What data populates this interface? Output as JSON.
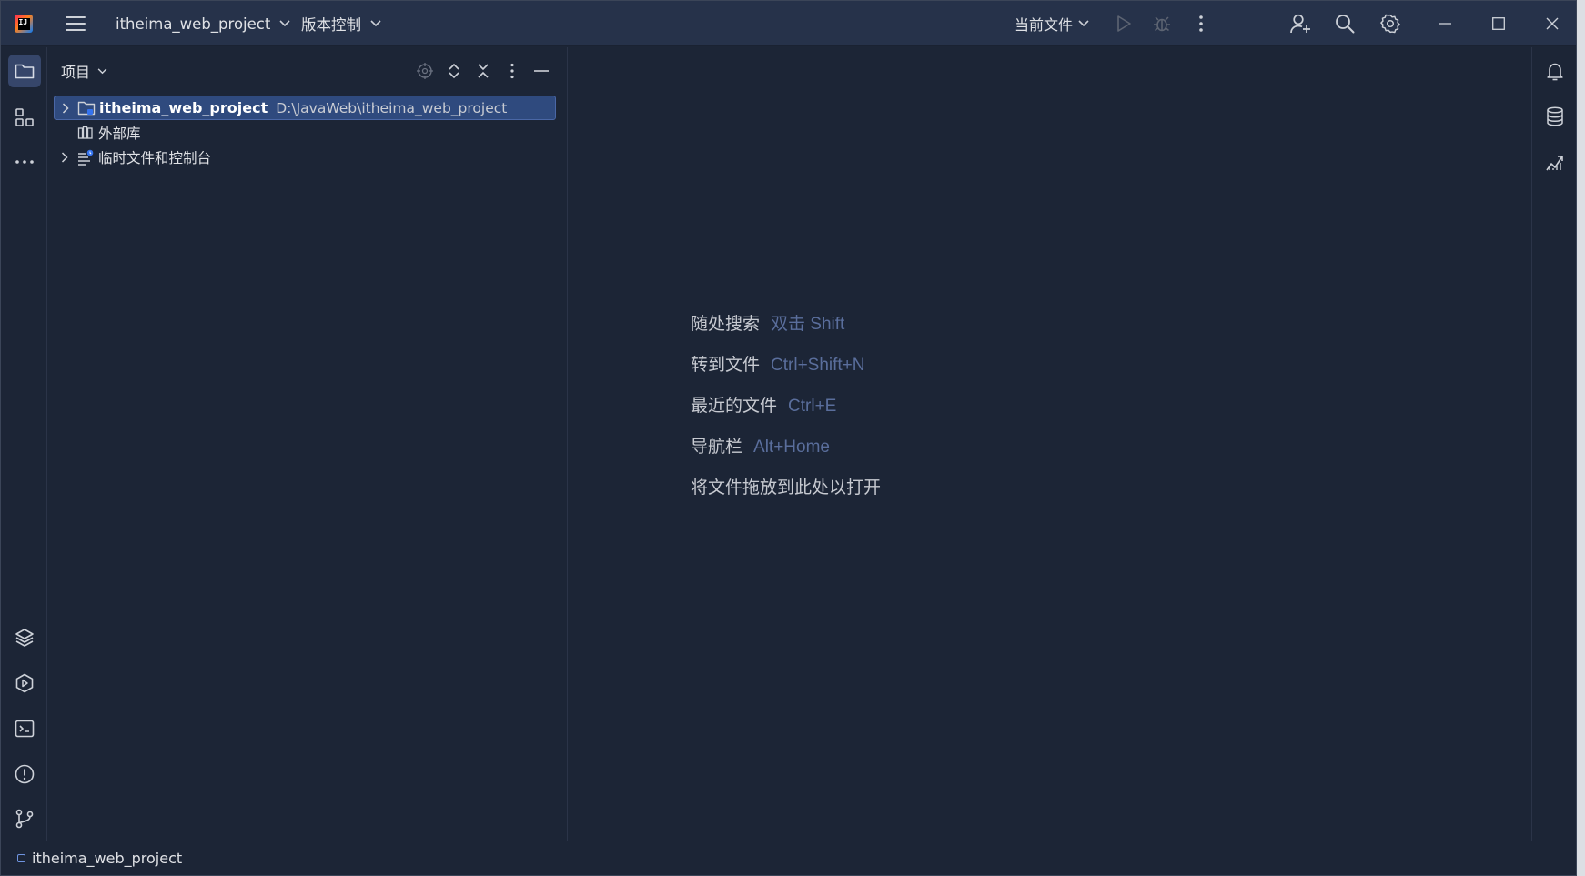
{
  "titlebar": {
    "logo_text": "IJ",
    "project_name": "itheima_web_project",
    "vcs_label": "版本控制",
    "run_config": "当前文件"
  },
  "project_panel": {
    "title": "项目",
    "tree": [
      {
        "name": "itheima_web_project",
        "path": "D:\\JavaWeb\\itheima_web_project",
        "expandable": true,
        "selected": true
      },
      {
        "name": "外部库",
        "expandable": false
      },
      {
        "name": "临时文件和控制台",
        "expandable": true
      }
    ]
  },
  "editor_hints": [
    {
      "label": "随处搜索",
      "shortcut": "双击 Shift"
    },
    {
      "label": "转到文件",
      "shortcut": "Ctrl+Shift+N"
    },
    {
      "label": "最近的文件",
      "shortcut": "Ctrl+E"
    },
    {
      "label": "导航栏",
      "shortcut": "Alt+Home"
    },
    {
      "label": "将文件拖放到此处以打开",
      "shortcut": ""
    }
  ],
  "statusbar": {
    "breadcrumb": "itheima_web_project"
  },
  "colors": {
    "background": "#1c2536",
    "titlebar": "#26324a",
    "selection": "#2f4a7e",
    "shortcut_text": "#5a6e9c",
    "icon": "#cdd1d8"
  }
}
